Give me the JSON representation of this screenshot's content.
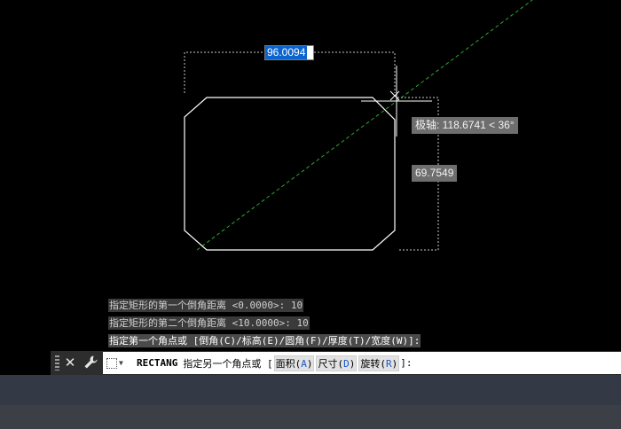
{
  "drawing": {
    "dim_width_value": "96.0094",
    "polar_tooltip": "极轴: 118.6741 < 36°",
    "dim_height_value": "69.7549",
    "colors": {
      "geometry": "#ffffff",
      "tracking_line": "#2fa52f",
      "dimension": "#c8c8c8"
    }
  },
  "command_history": [
    "指定矩形的第一个倒角距离 <0.0000>: 10",
    "指定矩形的第二个倒角距离 <10.0000>: 10",
    "指定第一个角点或 [倒角(C)/标高(E)/圆角(F)/厚度(T)/宽度(W)]:"
  ],
  "command_line": {
    "command": "RECTANG",
    "prompt": "指定另一个角点或 [",
    "options": [
      {
        "label": "面积(",
        "key": "A",
        "close": ")"
      },
      {
        "label": "尺寸(",
        "key": "D",
        "close": ")"
      },
      {
        "label": "旋转(",
        "key": "R",
        "close": ")"
      }
    ],
    "suffix": "]:"
  },
  "icons": {
    "close": "close-icon",
    "settings": "wrench-icon",
    "recent": "recent-commands-icon"
  }
}
